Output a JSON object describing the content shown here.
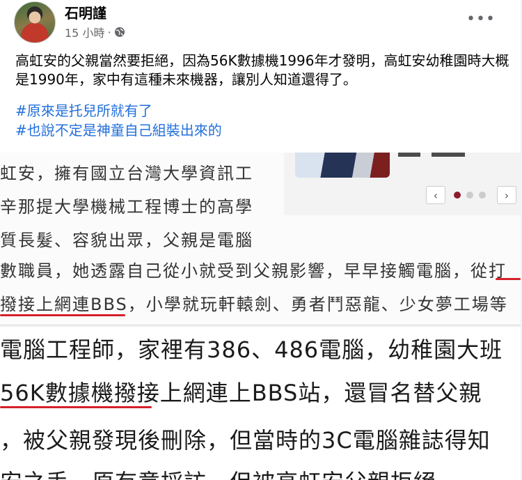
{
  "post": {
    "author": "石明謹",
    "time": "15 小時",
    "separator": "·",
    "privacy_icon": "globe-icon",
    "more_icon": "more-horizontal-icon",
    "text": "高虹安的父親當然要拒絕，因為56K數據機1996年才發明，高虹安幼稚園時大概是1990年，家中有這種未來機器，讓別人知道還得了。",
    "hashtags": [
      "#原來是托兒所就有了",
      "#也說不定是神童自己組裝出來的"
    ]
  },
  "screenshot_top": {
    "lines": [
      "虹安，擁有國立台灣大學資訊工",
      "辛那提大學機械工程博士的高學",
      "質長髮、容貌出眾，父親是電腦",
      "數職員，她透露自己從小就受到父親影響，早早接觸電腦，從打",
      "撥接上網連BBS，小學就玩軒轅劍、勇者鬥惡龍、少女夢工場等"
    ],
    "prev_icon": "chevron-left-icon",
    "next_icon": "chevron-right-icon",
    "carousel_pages": 3,
    "carousel_active": 1
  },
  "screenshot_bottom": {
    "lines": [
      "電腦工程師，家裡有386、486電腦，幼稚園大班",
      "56K數據機撥接上網連上BBS站，還冒名替父親",
      "，被父親發現後刪除，但當時的3C電腦雜誌得知",
      "安之手，原有意採訪，但被高虹安父親拒絕"
    ]
  },
  "colors": {
    "hashtag": "#216fdb",
    "underline": "#d6202a",
    "carousel_active": "#8b1c2e"
  }
}
